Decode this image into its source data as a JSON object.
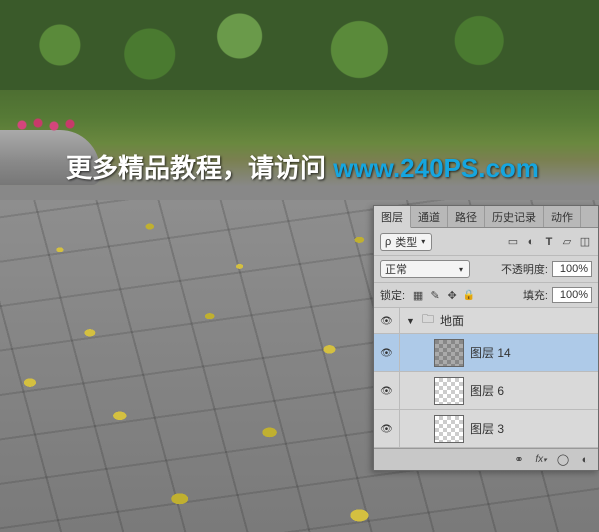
{
  "watermark": {
    "text": "更多精品教程，请访问 ",
    "url": "www.240PS.com"
  },
  "panel": {
    "tabs": [
      "图层",
      "通道",
      "路径",
      "历史记录",
      "动作"
    ],
    "active_tab": 0,
    "filter_icon": "ρ",
    "filter_label": "类型",
    "blend_mode": "正常",
    "opacity_label": "不透明度:",
    "opacity_value": "100%",
    "lock_label": "锁定:",
    "fill_label": "填充:",
    "fill_value": "100%",
    "group_name": "地面",
    "layers": [
      {
        "name": "图层 14",
        "selected": true,
        "thumb": "dark"
      },
      {
        "name": "图层 6",
        "selected": false,
        "thumb": "checker"
      },
      {
        "name": "图层 3",
        "selected": false,
        "thumb": "checker"
      }
    ]
  }
}
